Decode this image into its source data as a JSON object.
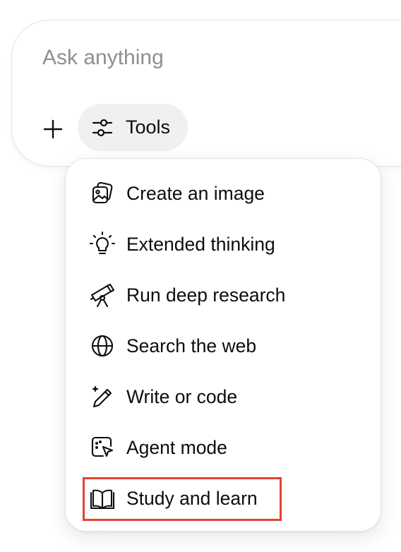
{
  "composer": {
    "placeholder": "Ask anything",
    "value": "",
    "plus_icon": "plus-icon",
    "tools_label": "Tools",
    "tools_icon": "sliders-icon"
  },
  "tools_menu": {
    "items": [
      {
        "label": "Create an image",
        "icon": "image-icon"
      },
      {
        "label": "Extended thinking",
        "icon": "lightbulb-icon"
      },
      {
        "label": "Run deep research",
        "icon": "telescope-icon"
      },
      {
        "label": "Search the web",
        "icon": "globe-icon"
      },
      {
        "label": "Write or code",
        "icon": "pen-sparkle-icon"
      },
      {
        "label": "Agent mode",
        "icon": "agent-cursor-icon"
      },
      {
        "label": "Study and learn",
        "icon": "book-icon"
      }
    ],
    "highlighted_item": "Study and learn"
  },
  "colors": {
    "highlight": "#e0442e",
    "tools_bg": "#f0f0f0",
    "placeholder": "#8f8f8f",
    "text": "#0d0d0d"
  }
}
